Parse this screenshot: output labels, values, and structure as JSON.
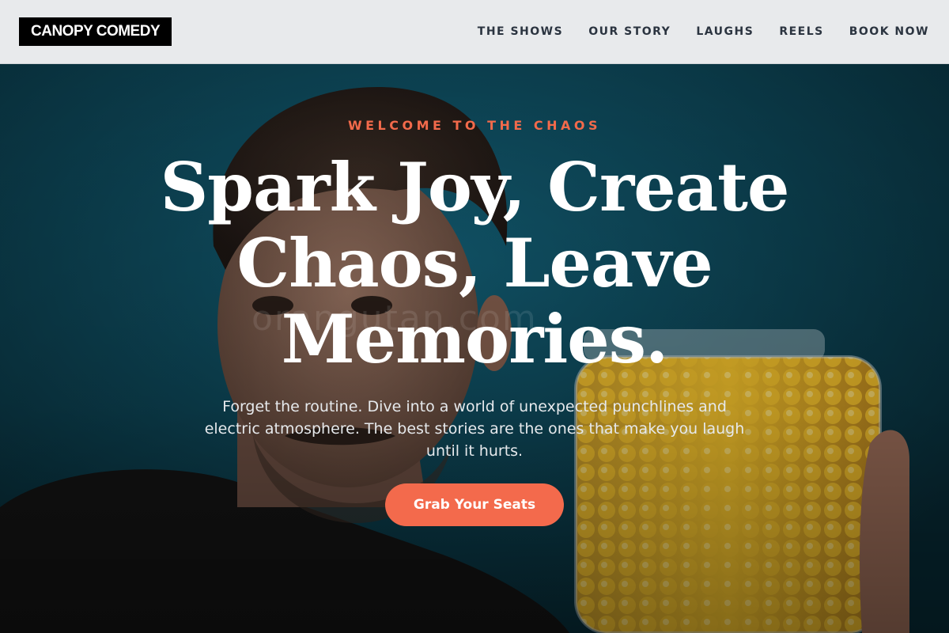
{
  "header": {
    "logo_text": "CANOPY COMEDY",
    "nav": [
      {
        "label": "THE SHOWS"
      },
      {
        "label": "OUR STORY"
      },
      {
        "label": "LAUGHS"
      },
      {
        "label": "REELS"
      },
      {
        "label": "BOOK NOW"
      }
    ]
  },
  "hero": {
    "eyebrow": "WELCOME TO THE CHAOS",
    "headline": "Spark Joy, Create Chaos, Leave Memories.",
    "subtext": "Forget the routine. Dive into a world of unexpected punchlines and electric atmosphere. The best stories are the ones that make you laugh until it hurts.",
    "cta_label": "Grab Your Seats",
    "watermark": "orangutan.com"
  },
  "colors": {
    "accent": "#f36a4c",
    "header_bg": "#e8eaec",
    "logo_bg": "#000000",
    "hero_bg": "#0c4e62"
  }
}
